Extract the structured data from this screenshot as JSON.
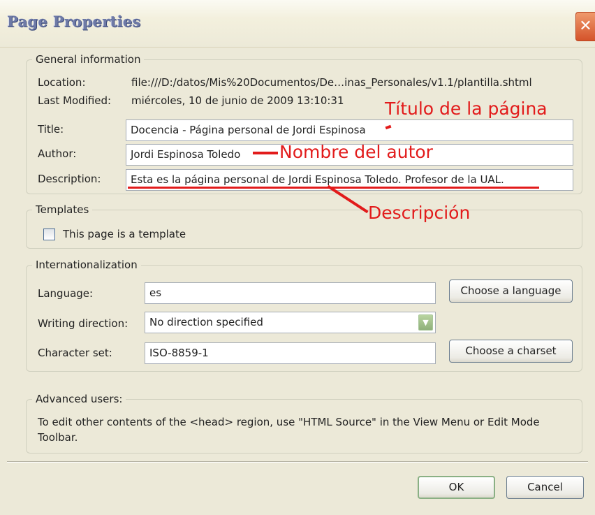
{
  "window": {
    "title": "Page Properties",
    "close_label": "✕"
  },
  "general": {
    "legend": "General information",
    "location_label": "Location:",
    "location_value": "file:///D:/datos/Mis%20Documentos/De…inas_Personales/v1.1/plantilla.shtml",
    "modified_label": "Last Modified:",
    "modified_value": "miércoles, 10 de junio de 2009 13:10:31",
    "title_label": "Title:",
    "title_value": "Docencia - Página personal de Jordi Espinosa",
    "author_label": "Author:",
    "author_value": "Jordi Espinosa Toledo",
    "description_label": "Description:",
    "description_value": "Esta es la página personal de Jordi Espinosa Toledo. Profesor de la UAL."
  },
  "templates": {
    "legend": "Templates",
    "checkbox_label": "This page is a template",
    "checked": false
  },
  "intl": {
    "legend": "Internationalization",
    "language_label": "Language:",
    "language_value": "es",
    "choose_language": "Choose a language",
    "direction_label": "Writing direction:",
    "direction_value": "No direction specified",
    "charset_label": "Character set:",
    "charset_value": "ISO-8859-1",
    "choose_charset": "Choose a charset"
  },
  "advanced": {
    "legend": "Advanced users:",
    "text": "To edit other contents of the <head> region, use \"HTML Source\" in the View Menu or Edit Mode Toolbar."
  },
  "buttons": {
    "ok": "OK",
    "cancel": "Cancel"
  },
  "annotations": {
    "titulo": "Título de la página",
    "autor": "Nombre del autor",
    "descripcion": "Descripción",
    "color": "#e21b1b"
  }
}
